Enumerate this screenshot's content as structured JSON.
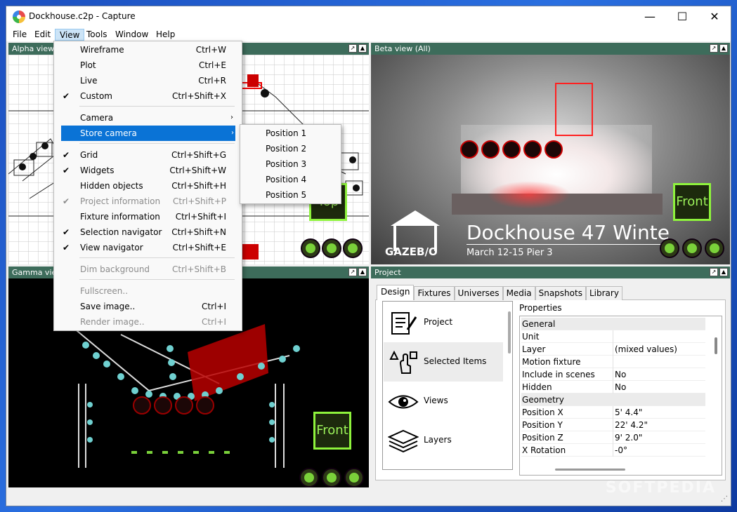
{
  "window": {
    "title": "Dockhouse.c2p - Capture"
  },
  "menubar": {
    "items": [
      "File",
      "Edit",
      "View",
      "Tools",
      "Window",
      "Help"
    ]
  },
  "view_menu": {
    "items": [
      {
        "label": "Wireframe",
        "shortcut": "Ctrl+W",
        "checked": false,
        "disabled": false
      },
      {
        "label": "Plot",
        "shortcut": "Ctrl+E",
        "checked": false,
        "disabled": false
      },
      {
        "label": "Live",
        "shortcut": "Ctrl+R",
        "checked": false,
        "disabled": false
      },
      {
        "label": "Custom",
        "shortcut": "Ctrl+Shift+X",
        "checked": true,
        "disabled": false
      },
      {
        "label": "Camera",
        "submenu": true
      },
      {
        "label": "Store camera",
        "submenu": true,
        "highlighted": true
      },
      {
        "label": "Grid",
        "shortcut": "Ctrl+Shift+G",
        "checked": true
      },
      {
        "label": "Widgets",
        "shortcut": "Ctrl+Shift+W",
        "checked": true
      },
      {
        "label": "Hidden objects",
        "shortcut": "Ctrl+Shift+H",
        "checked": false
      },
      {
        "label": "Project information",
        "shortcut": "Ctrl+Shift+P",
        "checked": true,
        "disabled": true
      },
      {
        "label": "Fixture information",
        "shortcut": "Ctrl+Shift+I",
        "checked": false
      },
      {
        "label": "Selection navigator",
        "shortcut": "Ctrl+Shift+N",
        "checked": true
      },
      {
        "label": "View navigator",
        "shortcut": "Ctrl+Shift+E",
        "checked": true
      },
      {
        "label": "Dim background",
        "shortcut": "Ctrl+Shift+B",
        "disabled": true
      },
      {
        "label": "Fullscreen..",
        "disabled": true
      },
      {
        "label": "Save image..",
        "shortcut": "Ctrl+I"
      },
      {
        "label": "Render image..",
        "shortcut": "Ctrl+I",
        "disabled": true
      }
    ],
    "check_glyph": "✔",
    "arrow_glyph": "›"
  },
  "store_camera_submenu": [
    "Position 1",
    "Position 2",
    "Position 3",
    "Position 4",
    "Position 5"
  ],
  "panels": {
    "alpha": {
      "title": "Alpha view",
      "nav_label": "Top"
    },
    "beta": {
      "title": "Beta view  (All)",
      "nav_label": "Front",
      "show_title": "Dockhouse 47 Winte",
      "show_subtitle": "March 12-15 Pier 3",
      "logo_text": "GAZEB/O"
    },
    "gamma": {
      "title": "Gamma view",
      "nav_label": "Front"
    },
    "project": {
      "title": "Project"
    }
  },
  "project": {
    "tabs": [
      "Design",
      "Fixtures",
      "Universes",
      "Media",
      "Snapshots",
      "Library"
    ],
    "list": [
      "Project",
      "Selected Items",
      "Views",
      "Layers"
    ],
    "properties_label": "Properties",
    "properties": [
      {
        "key": "General",
        "value": "",
        "group": true
      },
      {
        "key": "Unit",
        "value": ""
      },
      {
        "key": "Layer",
        "value": "(mixed values)"
      },
      {
        "key": "Motion fixture",
        "value": ""
      },
      {
        "key": "Include in scenes",
        "value": "No"
      },
      {
        "key": "Hidden",
        "value": "No"
      },
      {
        "key": "Geometry",
        "value": "",
        "group": true
      },
      {
        "key": "Position X",
        "value": "5' 4.4\""
      },
      {
        "key": "Position Y",
        "value": "22' 4.2\""
      },
      {
        "key": "Position Z",
        "value": "9' 2.0\""
      },
      {
        "key": "X Rotation",
        "value": "-0°"
      }
    ]
  },
  "watermark": "SOFTPEDIA",
  "colors": {
    "panel_header": "#3d6c5b",
    "menu_highlight": "#0a73d6",
    "widget_green": "#7ad13a"
  }
}
